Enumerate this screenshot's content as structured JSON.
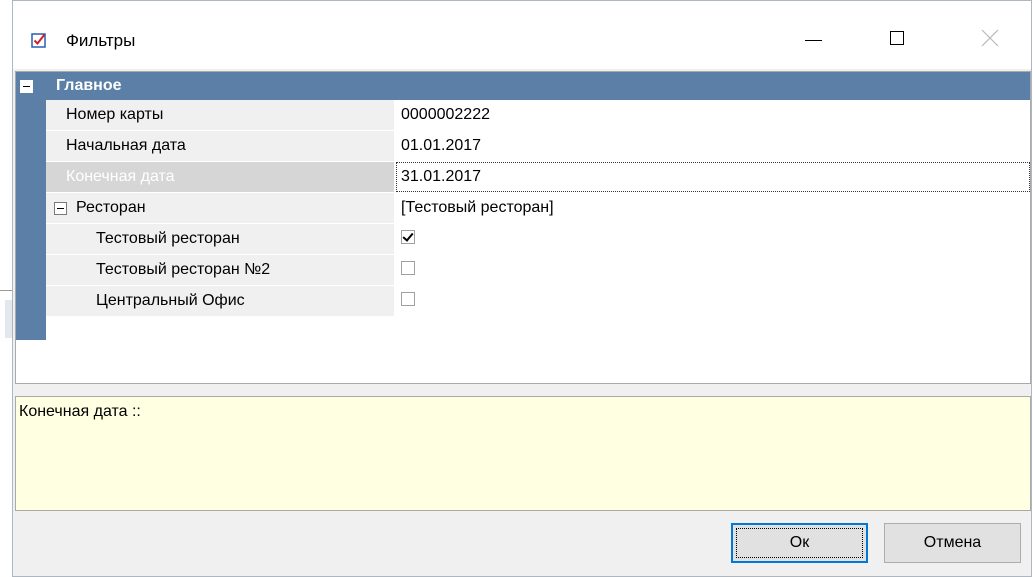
{
  "window": {
    "title": "Фильтры",
    "icon": "checkbox-checked-icon"
  },
  "grid": {
    "category": {
      "label": "Главное",
      "toggle": "collapse-icon"
    },
    "rows": [
      {
        "label": "Номер карты",
        "value": "0000002222"
      },
      {
        "label": "Начальная дата",
        "value": "01.01.2017"
      },
      {
        "label": "Конечная дата",
        "value": "31.01.2017",
        "selected": true
      },
      {
        "label": "Ресторан",
        "value": "[Тестовый ресторан]",
        "group": true
      },
      {
        "label": "Тестовый ресторан",
        "checked": true
      },
      {
        "label": "Тестовый ресторан №2",
        "checked": false
      },
      {
        "label": "Центральный Офис",
        "checked": false
      }
    ]
  },
  "description": {
    "text": "Конечная дата ::"
  },
  "buttons": {
    "ok": "Ок",
    "cancel": "Отмена"
  },
  "colors": {
    "category_bg": "#5b7fa6",
    "description_bg": "#ffffe1",
    "focus_border": "#0078d7"
  }
}
